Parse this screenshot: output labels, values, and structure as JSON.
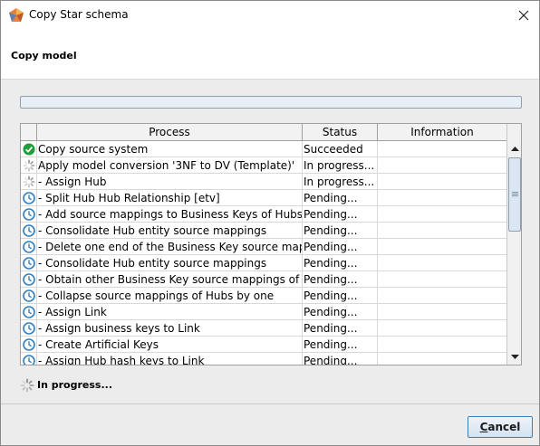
{
  "window": {
    "title": "Copy Star schema",
    "app_icon": "star-schema-app-icon",
    "close_icon": "close-icon"
  },
  "header": {
    "title": "Copy model"
  },
  "progress": {
    "value": 0
  },
  "table": {
    "columns": [
      "Process",
      "Status",
      "Information"
    ],
    "rows": [
      {
        "icon": "check-icon",
        "process": "Copy source system",
        "status": "Succeeded",
        "information": ""
      },
      {
        "icon": "spinner-icon",
        "process": "Apply model conversion '3NF to DV (Template)'",
        "status": "In progress...",
        "information": ""
      },
      {
        "icon": "spinner-icon",
        "process": "- Assign Hub",
        "status": "In progress...",
        "information": ""
      },
      {
        "icon": "clock-icon",
        "process": "- Split Hub Hub Relationship [etv]",
        "status": "Pending...",
        "information": ""
      },
      {
        "icon": "clock-icon",
        "process": "- Add source mappings to Business Keys of Hubs",
        "status": "Pending...",
        "information": ""
      },
      {
        "icon": "clock-icon",
        "process": "- Consolidate Hub entity source mappings",
        "status": "Pending...",
        "information": ""
      },
      {
        "icon": "clock-icon",
        "process": "- Delete one end of the Business Key source mapp...",
        "status": "Pending...",
        "information": ""
      },
      {
        "icon": "clock-icon",
        "process": "- Consolidate Hub entity source mappings",
        "status": "Pending...",
        "information": ""
      },
      {
        "icon": "clock-icon",
        "process": "- Obtain other Business Key source mappings of H...",
        "status": "Pending...",
        "information": ""
      },
      {
        "icon": "clock-icon",
        "process": "- Collapse source mappings of Hubs by one",
        "status": "Pending...",
        "information": ""
      },
      {
        "icon": "clock-icon",
        "process": "- Assign Link",
        "status": "Pending...",
        "information": ""
      },
      {
        "icon": "clock-icon",
        "process": "- Assign business keys to Link",
        "status": "Pending...",
        "information": ""
      },
      {
        "icon": "clock-icon",
        "process": "- Create Artificial Keys",
        "status": "Pending...",
        "information": ""
      },
      {
        "icon": "clock-icon",
        "process": "- Assign Hub hash keys to Link",
        "status": "Pending...",
        "information": ""
      }
    ]
  },
  "status": {
    "icon": "spinner-icon",
    "text": "In progress..."
  },
  "buttons": {
    "cancel_underlined": "C",
    "cancel_rest": "ancel"
  },
  "colors": {
    "success": "#1e9e3a",
    "clock": "#2f7fc1",
    "spinner": "#8a8a8a",
    "button_border": "#3c7fb1"
  }
}
